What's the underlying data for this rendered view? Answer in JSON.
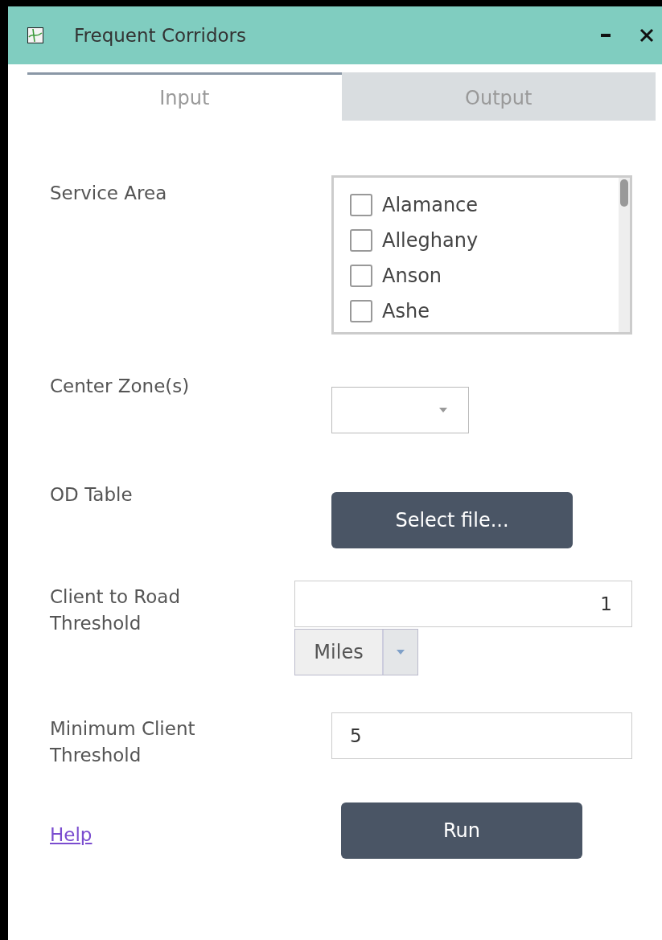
{
  "window": {
    "title": "Frequent Corridors"
  },
  "tabs": [
    {
      "label": "Input",
      "selected": true
    },
    {
      "label": "Output",
      "selected": false
    }
  ],
  "service_area": {
    "label": "Service Area",
    "items": [
      {
        "label": "Alamance",
        "checked": false
      },
      {
        "label": "Alleghany",
        "checked": false
      },
      {
        "label": "Anson",
        "checked": false
      },
      {
        "label": "Ashe",
        "checked": false
      }
    ]
  },
  "center_zones": {
    "label": "Center Zone(s)"
  },
  "od_table": {
    "label": "OD Table",
    "button": "Select file..."
  },
  "client_to_road": {
    "label": "Client to Road Threshold",
    "value": "1",
    "unit": "Miles"
  },
  "minimum_client": {
    "label": "Minimum Client Threshold",
    "value": "5"
  },
  "help_link": "Help",
  "run_button": "Run"
}
